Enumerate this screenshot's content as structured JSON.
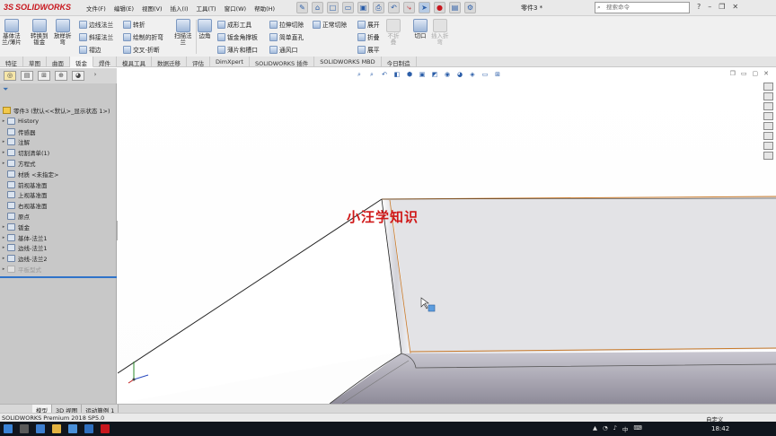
{
  "app": {
    "logo_prefix": "3S",
    "logo_text": "SOLIDWORKS",
    "document_title": "零件3 *",
    "search_placeholder": "搜索命令"
  },
  "menu": [
    "文件(F)",
    "编辑(E)",
    "视图(V)",
    "插入(I)",
    "工具(T)",
    "窗口(W)",
    "帮助(H)"
  ],
  "ribbon": {
    "big": [
      {
        "id": "base-flange",
        "label1": "基体法",
        "label2": "兰/薄片",
        "disabled": false
      },
      {
        "id": "convert-to-sheet",
        "label1": "转换到",
        "label2": "钣金",
        "disabled": false
      },
      {
        "id": "lofted-bend",
        "label1": "放样折",
        "label2": "弯",
        "disabled": false
      },
      {
        "id": "swept-flange",
        "label1": "扫描法",
        "label2": "兰",
        "disabled": false
      },
      {
        "id": "corners",
        "label1": "边角",
        "label2": "",
        "disabled": false
      },
      {
        "id": "no-bends",
        "label1": "不折",
        "label2": "叠",
        "disabled": true
      },
      {
        "id": "rip",
        "label1": "切口",
        "label2": "",
        "disabled": false
      },
      {
        "id": "insert-bends",
        "label1": "插入折",
        "label2": "弯",
        "disabled": true
      }
    ],
    "small": {
      "edge_flange": "边线法兰",
      "miter_flange": "斜接法兰",
      "hem": "褶边",
      "sketched_bend": "转折",
      "bend_sketch": "绘制的折弯",
      "cross_break": "交叉-折断",
      "forming_tool": "成形工具",
      "gusset": "钣金角撑板",
      "tab_slot": "薄片和槽口",
      "extruded_cut": "拉伸切除",
      "simple_hole": "简单直孔",
      "vent": "通风口",
      "normal_cut": "正常切除",
      "unfold": "展开",
      "fold": "折叠",
      "flatten": "展平"
    }
  },
  "command_tabs": [
    {
      "label": "特征",
      "active": false
    },
    {
      "label": "草图",
      "active": false
    },
    {
      "label": "曲面",
      "active": false
    },
    {
      "label": "钣金",
      "active": true
    },
    {
      "label": "焊件",
      "active": false
    },
    {
      "label": "模具工具",
      "active": false
    },
    {
      "label": "数据迁移",
      "active": false
    },
    {
      "label": "评估",
      "active": false
    },
    {
      "label": "DimXpert",
      "active": false
    },
    {
      "label": "SOLIDWORKS 插件",
      "active": false
    },
    {
      "label": "SOLIDWORKS MBD",
      "active": false
    },
    {
      "label": "今日制造",
      "active": false
    }
  ],
  "tree": {
    "root": "零件3 (默认<<默认>_显示状态 1>)",
    "nodes": [
      {
        "label": "History",
        "expandable": true,
        "dim": false
      },
      {
        "label": "传感器",
        "expandable": false,
        "dim": false
      },
      {
        "label": "注解",
        "expandable": true,
        "dim": false
      },
      {
        "label": "切割清单(1)",
        "expandable": true,
        "dim": false
      },
      {
        "label": "方程式",
        "expandable": true,
        "dim": false
      },
      {
        "label": "材质 <未指定>",
        "expandable": false,
        "dim": false
      },
      {
        "label": "前视基准面",
        "expandable": false,
        "dim": false
      },
      {
        "label": "上视基准面",
        "expandable": false,
        "dim": false
      },
      {
        "label": "右视基准面",
        "expandable": false,
        "dim": false
      },
      {
        "label": "原点",
        "expandable": false,
        "dim": false
      },
      {
        "label": "钣金",
        "expandable": true,
        "dim": false
      },
      {
        "label": "基体-法兰1",
        "expandable": true,
        "dim": false
      },
      {
        "label": "边线-法兰1",
        "expandable": true,
        "dim": false
      },
      {
        "label": "边线-法兰2",
        "expandable": true,
        "dim": false
      },
      {
        "label": "平板型式",
        "expandable": true,
        "dim": true
      }
    ]
  },
  "viewport": {
    "watermark": "小汪学知识"
  },
  "model_tabs": [
    {
      "label": "模型",
      "active": true
    },
    {
      "label": "3D 视图",
      "active": false
    },
    {
      "label": "运动算例 1",
      "active": false
    }
  ],
  "status": {
    "left": "SOLIDWORKS Premium 2018 SP5.0",
    "right": "自定义"
  },
  "taskbar": {
    "time": "18:42"
  }
}
